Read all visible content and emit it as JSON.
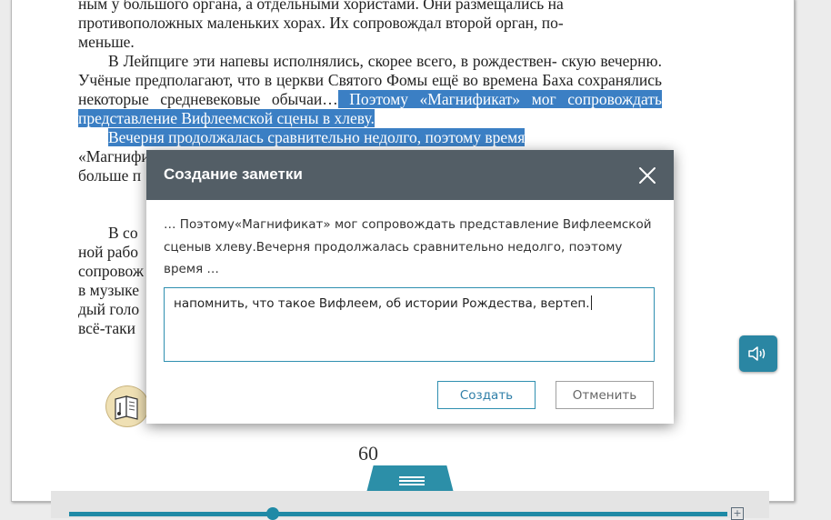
{
  "book": {
    "lines": [
      {
        "text": "ным у большого органа, а отдельными хористами. Они размещались на",
        "indent": false
      },
      {
        "text": "противоположных маленьких хорах. Их сопровождал второй орган, по-",
        "indent": false
      },
      {
        "text": "меньше.",
        "indent": false
      }
    ],
    "paragraph2_plain": "В Лейпциге эти напевы исполнялись, скорее всего, в рождествен- скую вечерню. Учёные предполагают, что в церкви Святого Фомы ещё во времена Баха сохранялись некоторые средневековые обычаи…",
    "paragraph2_highlight": " Поэтому «Магнификат» мог сопровождать представление Вифлеемской сцены в хлеву.",
    "paragraph3_highlight": "Вечерня продолжалась сравнительно недолго, поэтому время",
    "fragment_lines": [
      "«Магнификат»",
      "больше п"
    ],
    "paragraph4_lines": [
      "В со",
      "ной рабо",
      "сопровож",
      "в музыке",
      "дый голо",
      "всё-таки"
    ],
    "page_number": "60"
  },
  "dialog": {
    "title": "Создание заметки",
    "quote": "… Поэтому«Магнификат» мог сопровождать представление Вифлеемской сценыв хлеву.Вечерня продолжалась сравнительно недолго, поэтому время …",
    "note_value": "напомнить, что такое Вифлеем, об истории Рождества, вертеп.",
    "create_label": "Создать",
    "cancel_label": "Отменить"
  },
  "player": {
    "progress": 0.31
  },
  "icons": {
    "close": "close-icon",
    "audio": "speaker-icon",
    "book": "music-book-icon",
    "handle": "menu-lines-icon",
    "expand": "plus-box-icon"
  },
  "colors": {
    "accent": "#2a86a3",
    "highlight": "#3b7fc4",
    "dialog_header": "#535e66"
  }
}
